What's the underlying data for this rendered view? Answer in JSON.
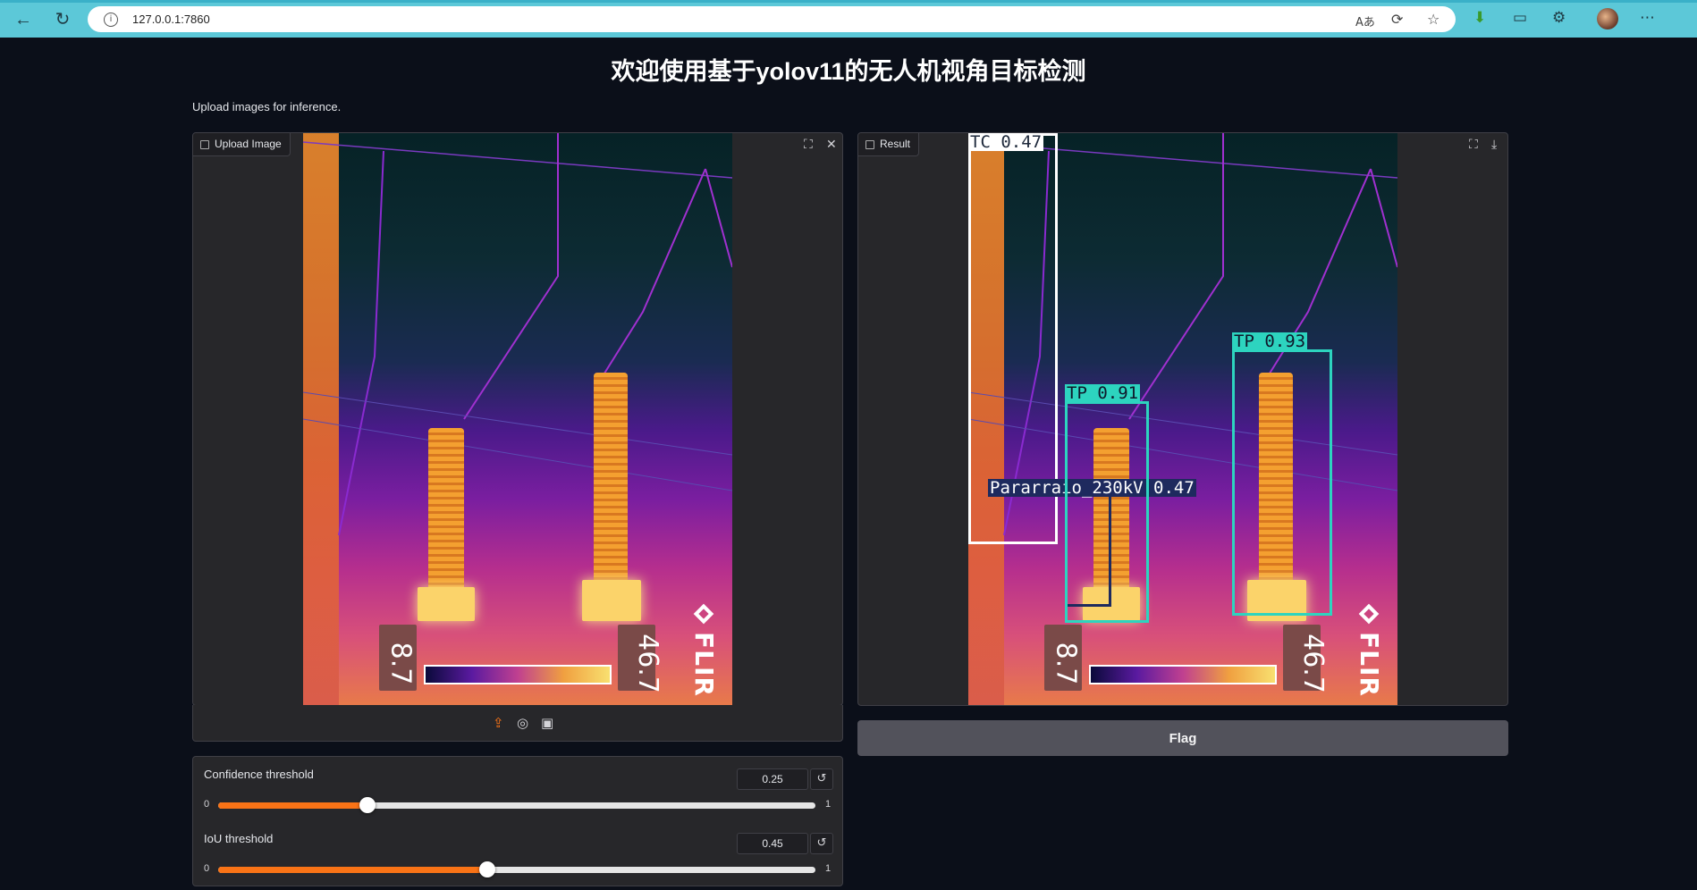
{
  "browser": {
    "url": "127.0.0.1:7860"
  },
  "page": {
    "title": "欢迎使用基于yolov11的无人机视角目标检测",
    "description": "Upload images for inference."
  },
  "input_panel": {
    "label": "Upload Image",
    "icons": [
      "image-icon",
      "fullscreen-icon",
      "close-icon",
      "upload-icon",
      "webcam-icon",
      "clipboard-icon"
    ]
  },
  "output_panel": {
    "label": "Result",
    "icons": [
      "image-icon",
      "fullscreen-icon",
      "download-icon"
    ],
    "detections": [
      {
        "label": "TC 0.47",
        "color": "#ffffff",
        "text_color": "#1e293b"
      },
      {
        "label": "TP 0.91",
        "color": "#2dd4bf",
        "text_color": "#0f172a"
      },
      {
        "label": "Pararraio_230kV 0.47",
        "color": "#1e2a5e",
        "text_color": "#ffffff"
      },
      {
        "label": "TP 0.93",
        "color": "#2dd4bf",
        "text_color": "#0f172a"
      }
    ]
  },
  "thermal": {
    "min_temp": "8.7",
    "max_temp": "46.7",
    "brand": "FLIR"
  },
  "flag_button": "Flag",
  "controls": {
    "confidence": {
      "label": "Confidence threshold",
      "value": "0.25",
      "min": "0",
      "max": "1",
      "fraction": 0.25
    },
    "iou": {
      "label": "IoU threshold",
      "value": "0.45",
      "min": "0",
      "max": "1",
      "fraction": 0.45
    }
  },
  "colors": {
    "accent": "#f97316",
    "background": "#0b0f19",
    "browser_chrome": "#5cc8d8"
  }
}
